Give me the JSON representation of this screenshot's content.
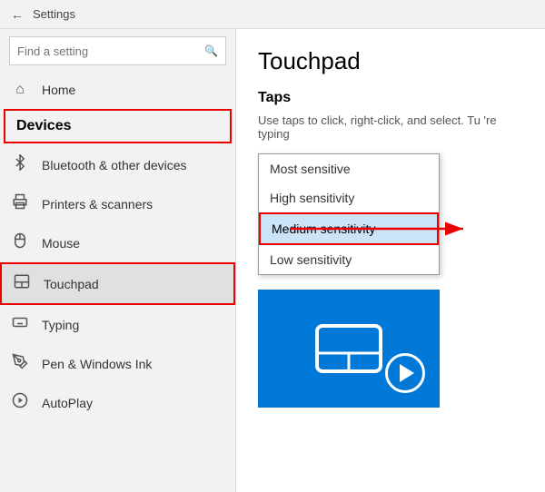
{
  "titleBar": {
    "backLabel": "←",
    "title": "Settings"
  },
  "sidebar": {
    "homeLabel": "Home",
    "searchPlaceholder": "Find a setting",
    "devicesLabel": "Devices",
    "navItems": [
      {
        "id": "bluetooth",
        "icon": "bluetooth",
        "label": "Bluetooth & other devices"
      },
      {
        "id": "printers",
        "icon": "printer",
        "label": "Printers & scanners"
      },
      {
        "id": "mouse",
        "icon": "mouse",
        "label": "Mouse"
      },
      {
        "id": "touchpad",
        "icon": "touchpad",
        "label": "Touchpad",
        "active": true
      },
      {
        "id": "typing",
        "icon": "keyboard",
        "label": "Typing"
      },
      {
        "id": "pen",
        "icon": "pen",
        "label": "Pen & Windows Ink"
      },
      {
        "id": "autoplay",
        "icon": "autoplay",
        "label": "AutoPlay"
      }
    ]
  },
  "content": {
    "pageTitle": "Touchpad",
    "sectionTitle": "Taps",
    "description": "Use taps to click, right-click, and select. Tu 're typing",
    "dropdownItems": [
      {
        "id": "most-sensitive",
        "label": "Most sensitive"
      },
      {
        "id": "high-sensitivity",
        "label": "High sensitivity"
      },
      {
        "id": "medium-sensitivity",
        "label": "Medium sensitivity",
        "selected": true
      },
      {
        "id": "low-sensitivity",
        "label": "Low sensitivity"
      }
    ]
  },
  "icons": {
    "back": "←",
    "search": "🔍",
    "home": "⌂",
    "bluetooth": "ʙ",
    "printer": "🖨",
    "mouse": "🖱",
    "touchpad": "⊡",
    "keyboard": "⌨",
    "pen": "✒",
    "autoplay": "▶"
  }
}
